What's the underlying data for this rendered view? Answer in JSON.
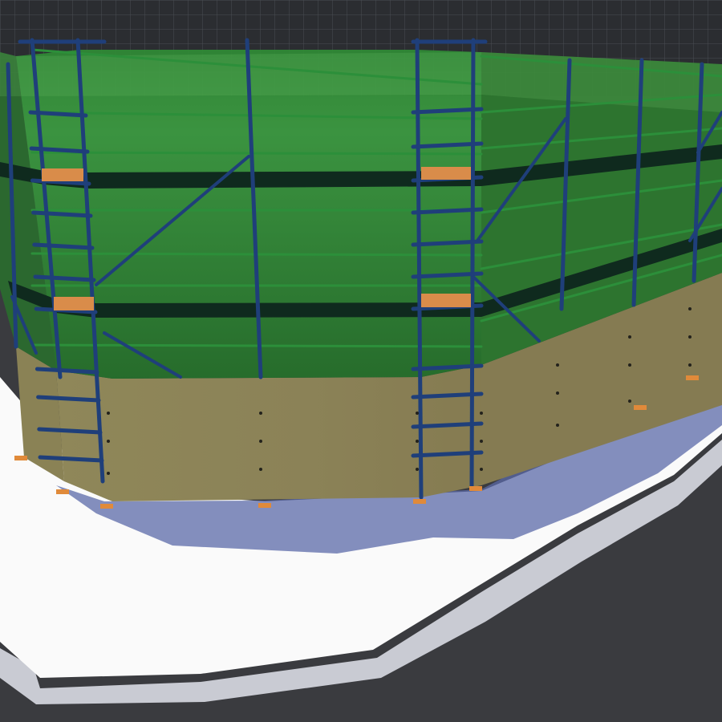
{
  "viewport": {
    "kind": "3d-scaffold-model-view",
    "background_color": "#3a3b3f",
    "grid_wall_color": "#2b2d31",
    "grid_line_color": "#4a4d54"
  },
  "scene": {
    "ground": {
      "slab_top_color": "#fafafa",
      "slab_edge_color": "#c9cbd3",
      "shadow_color": "#5b6aa8"
    },
    "hoarding": {
      "color": "#8b8257",
      "bolt_color": "#23221c"
    },
    "netting": {
      "color": "#2d7a2e",
      "band_color": "#0f2a1e"
    },
    "scaffold": {
      "tube_color": "#1f3f7a",
      "ledger_color": "#2c8f3a",
      "board_color": "#d98c4a",
      "base_plate_color": "#e08a3a"
    }
  }
}
